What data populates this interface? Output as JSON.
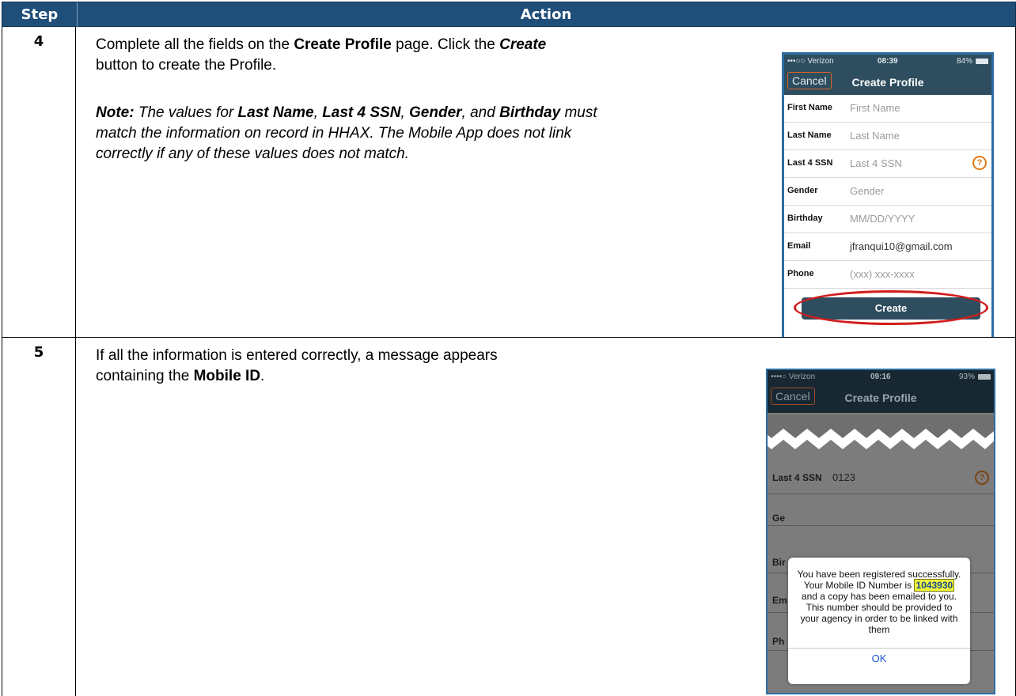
{
  "header": {
    "step": "Step",
    "action": "Action"
  },
  "rows": [
    {
      "step": "4",
      "line1_pre": "Complete all the fields on the ",
      "line1_bold": "Create Profile",
      "line1_post": " page. Click the ",
      "line1_create": "Create",
      "line2": "button to create the Profile.",
      "note_label": "Note:",
      "note_1": " The values for ",
      "note_b1": "Last Name",
      "note_2": ", ",
      "note_b2": "Last 4 SSN",
      "note_3": ", ",
      "note_b3": "Gender",
      "note_4": ", and ",
      "note_b4": "Birthday",
      "note_5": " must",
      "note_line2": "match the information on record in HHAX. The Mobile App does not link",
      "note_line3": "correctly if any of these values does not match."
    },
    {
      "step": "5",
      "line1": "If all the information is entered correctly, a message appears",
      "line2_pre": "containing the ",
      "line2_bold": "Mobile ID",
      "line2_post": "."
    }
  ],
  "phone1": {
    "carrier": "•••○○ Verizon",
    "time": "08:39",
    "battery": "84%",
    "cancel": "Cancel",
    "title": "Create Profile",
    "fields": [
      {
        "label": "First Name",
        "value": "First Name"
      },
      {
        "label": "Last Name",
        "value": "Last Name"
      },
      {
        "label": "Last 4 SSN",
        "value": "Last 4 SSN"
      },
      {
        "label": "Gender",
        "value": "Gender"
      },
      {
        "label": "Birthday",
        "value": "MM/DD/YYYY"
      },
      {
        "label": "Email",
        "value": "jfranqui10@gmail.com"
      },
      {
        "label": "Phone",
        "value": "(xxx) xxx-xxxx"
      }
    ],
    "help_glyph": "?",
    "create": "Create"
  },
  "phone2": {
    "carrier": "••••○ Verizon",
    "time": "09:16",
    "battery": "93%",
    "cancel": "Cancel",
    "title": "Create Profile",
    "ssn_label": "Last 4 SSN",
    "ssn_value": "0123",
    "help_glyph": "?",
    "partial_labels": [
      "Ge",
      "Bir",
      "Em",
      "Ph"
    ],
    "dialog_pre": "You have been registered successfully. Your Mobile ID Number is ",
    "dialog_id": "1043930",
    "dialog_post": " and a copy has been emailed to you. This number should be provided to your agency in order to be linked with them",
    "ok": "OK"
  }
}
